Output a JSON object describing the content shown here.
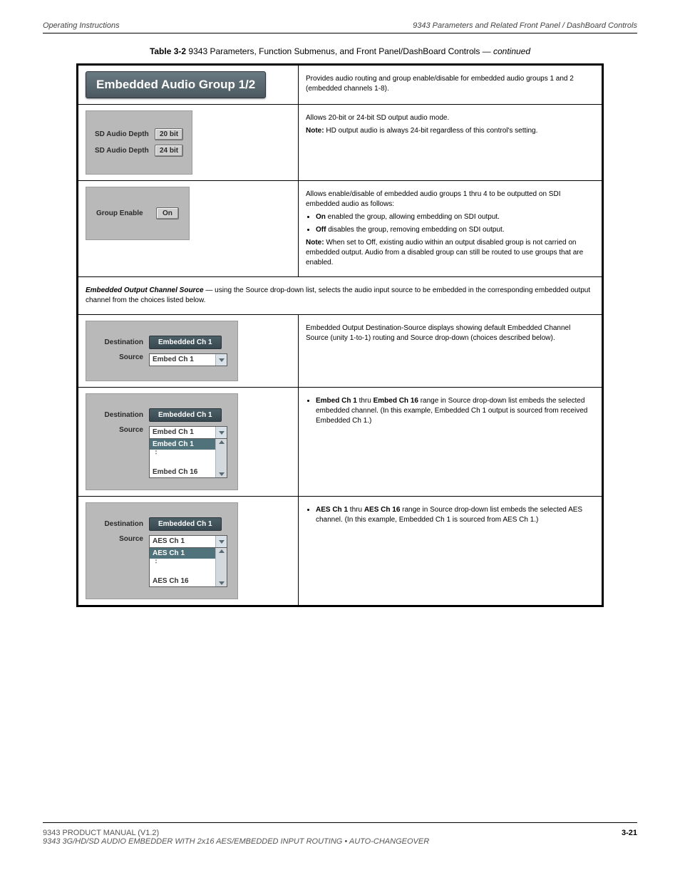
{
  "header": {
    "left": "Operating Instructions",
    "right": "9343 Parameters and Related Front Panel / DashBoard Controls"
  },
  "caption": {
    "table_label": "Table 3-2",
    "table_title": "9343 Parameters, Function Submenus, and Front Panel/DashBoard Controls",
    "cont": " — continued"
  },
  "rows": {
    "title_pill": "Embedded Audio Group 1/2",
    "title_desc": "Provides audio routing and group enable/disable for embedded audio groups 1 and 2 (embedded channels 1-8).",
    "sd_depth": {
      "label": "SD Audio Depth",
      "opt1": "20 bit",
      "opt2": "24 bit",
      "desc_lead": "Allows 20-bit or 24-bit SD output audio mode.",
      "desc_note": "HD output audio is always 24-bit regardless of this control's setting."
    },
    "group_enable": {
      "label": "Group Enable",
      "value": "On",
      "desc_intro": "Allows enable/disable of embedded audio groups 1 thru 4 to be outputted on SDI embedded audio as follows:",
      "bullet_on_label": "On",
      "bullet_on_text": " enabled the group, allowing embedding on SDI output.",
      "bullet_off_label": "Off",
      "bullet_off_text": " disables the group, removing embedding on SDI output.",
      "note_label": "Note:",
      "note_text": " When set to Off, existing audio within an output disabled group is not carried on embedded output. Audio from a disabled group can still be routed to use groups that are enabled."
    },
    "spanner": {
      "bold": "Embedded Output Channel Source",
      "rest": " — using the Source drop-down list, selects the audio input source to be embedded in the corresponding embedded output channel from the choices listed below."
    },
    "collapsed": {
      "dest_label": "Destination",
      "dest_value": "Embedded Ch 1",
      "src_label": "Source",
      "src_value": "Embed Ch 1",
      "desc": "Embedded Output Destination-Source displays showing default Embedded Channel Source (unity 1-to-1) routing and Source drop-down (choices described below)."
    },
    "list1": {
      "dest_label": "Destination",
      "dest_value": "Embedded Ch 1",
      "src_label": "Source",
      "src_value": "Embed Ch 1",
      "opt_first": "Embed Ch 1",
      "opt_last": "Embed Ch 16",
      "bullet_label": "Embed Ch 1",
      "bullet_mid": " thru ",
      "bullet_label2": "Embed Ch 16",
      "bullet_text": " range in Source drop-down list embeds the selected embedded channel. (In this example, Embedded Ch 1 output is sourced from received Embedded Ch 1.)"
    },
    "list2": {
      "dest_label": "Destination",
      "dest_value": "Embedded Ch 1",
      "src_label": "Source",
      "src_value": "AES Ch 1",
      "opt_first": "AES Ch 1",
      "opt_last": "AES Ch 16",
      "bullet_label": "AES Ch 1",
      "bullet_mid": " thru ",
      "bullet_label2": "AES Ch 16",
      "bullet_text": " range in Source drop-down list embeds the selected AES channel. (In this example, Embedded Ch 1 is sourced from AES Ch 1.)"
    }
  },
  "footer": {
    "version": "9343 PRODUCT MANUAL (V1.2)",
    "page": "3-21",
    "blurb": "9343 3G/HD/SD AUDIO EMBEDDER WITH 2x16 AES/EMBEDDED INPUT ROUTING • AUTO-CHANGEOVER"
  }
}
